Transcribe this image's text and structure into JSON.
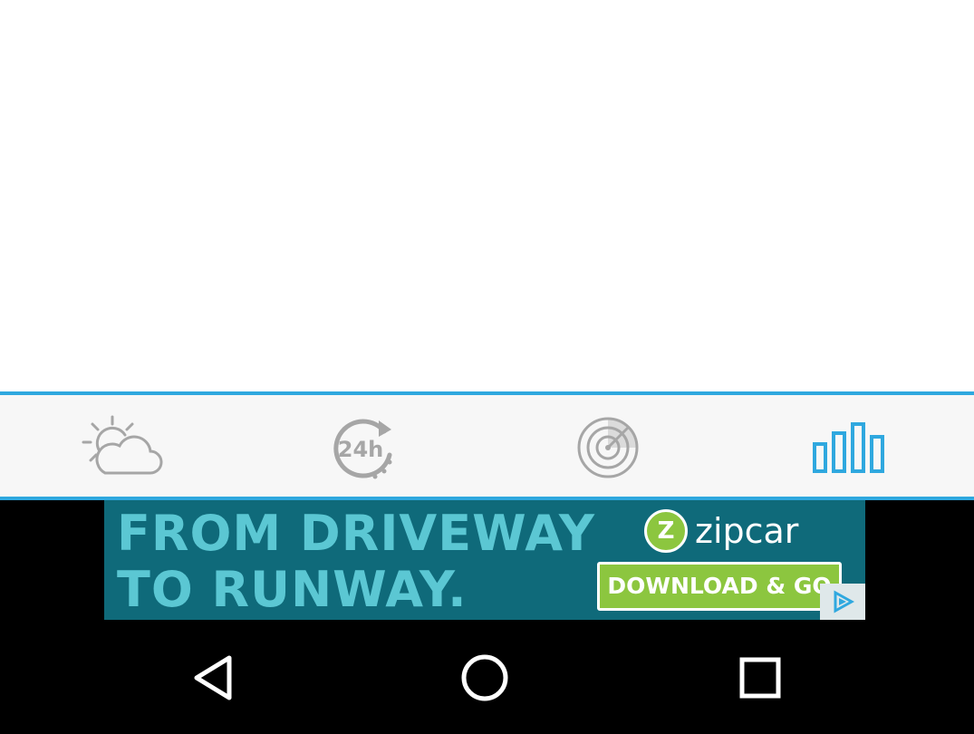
{
  "tabbar": {
    "accent_color": "#2fa8df",
    "icon_color": "#a6a6a6",
    "active_tab": "stats",
    "tabs": [
      {
        "id": "current",
        "icon": "partly-cloudy-icon"
      },
      {
        "id": "hourly",
        "icon": "24h-clock-icon",
        "icon_text": "24h"
      },
      {
        "id": "radar",
        "icon": "radar-icon"
      },
      {
        "id": "stats",
        "icon": "bar-chart-icon"
      }
    ]
  },
  "ad": {
    "headline_line1": "FROM DRIVEWAY",
    "headline_line2": "TO RUNWAY.",
    "brand_mark": "Z",
    "brand": "zipcar",
    "cta": "DOWNLOAD & GO",
    "background_color": "#0f6a7a",
    "headline_color": "#5bc7d3",
    "cta_color": "#8cc63f",
    "adchoices_icon": "adchoices-icon"
  },
  "navbar": {
    "buttons": [
      {
        "id": "back",
        "icon": "back-triangle-icon"
      },
      {
        "id": "home",
        "icon": "home-circle-icon"
      },
      {
        "id": "recents",
        "icon": "recents-square-icon"
      }
    ]
  }
}
